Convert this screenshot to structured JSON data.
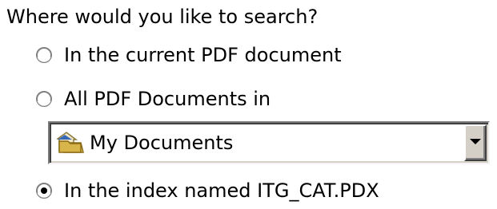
{
  "search_scope": {
    "question": "Where would you like to search?",
    "options": [
      {
        "label": "In the current PDF document",
        "selected": false
      },
      {
        "label": "All PDF Documents in",
        "selected": false
      },
      {
        "label": "In the index named ITG_CAT.PDX",
        "selected": true
      }
    ],
    "folder": {
      "value": "My Documents",
      "icon": "folder-icon"
    },
    "dropdown_icon": "chevron-down-icon"
  }
}
